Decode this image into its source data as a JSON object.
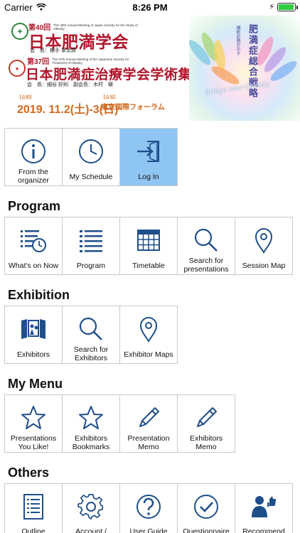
{
  "status_bar": {
    "carrier": "Carrier",
    "time": "8:26 PM",
    "battery_level": 0.95
  },
  "banner": {
    "conf1_ordinal": "第40回",
    "conf1_english": "The 40th Annual Meeting of Japan Society for the Study of Obesity",
    "conf1_title": "日本肥満学会",
    "conf1_president": "会　長：横手 幸太郎",
    "conf2_ordinal": "第37回",
    "conf2_english": "The 37th Annual Meeting of the Japanese Society for Treatment of Obesity",
    "conf2_title": "日本肥満症治療学会学術集会",
    "conf2_president": "会　長：細谷 好則　副会長：木村　穣",
    "period_label": "【会期】",
    "dates": "2019. 11.2(土)-3(日)",
    "venue_label": "【会場】",
    "venue": "東京国際フォーラム",
    "art_vertical_small": "横断診療が示す",
    "art_vertical": "肥満症総合戦略",
    "art_caption": "Bridge over Obesity"
  },
  "top_tiles": [
    {
      "name": "from-the-organizer",
      "icon": "info-icon",
      "label": "From the organizer",
      "active": false
    },
    {
      "name": "my-schedule",
      "icon": "clock-icon",
      "label": "My Schedule",
      "active": false
    },
    {
      "name": "log-in",
      "icon": "login-icon",
      "label": "Log In",
      "active": true
    }
  ],
  "sections": {
    "program": {
      "title": "Program",
      "tiles": [
        {
          "name": "whats-on-now",
          "icon": "list-clock-icon",
          "label": "What's on Now"
        },
        {
          "name": "program",
          "icon": "list-icon",
          "label": "Program"
        },
        {
          "name": "timetable",
          "icon": "calendar-grid-icon",
          "label": "Timetable"
        },
        {
          "name": "search-presentations",
          "icon": "search-icon",
          "label": "Search for presentations"
        },
        {
          "name": "session-map",
          "icon": "map-pin-icon",
          "label": "Session Map"
        }
      ]
    },
    "exhibition": {
      "title": "Exhibition",
      "tiles": [
        {
          "name": "exhibitors",
          "icon": "exhibitor-booth-icon",
          "label": "Exhibitors"
        },
        {
          "name": "search-exhibitors",
          "icon": "search-icon",
          "label": "Search for Exhibitors"
        },
        {
          "name": "exhibitor-maps",
          "icon": "map-pin-icon",
          "label": "Exhibitor Maps"
        }
      ]
    },
    "my_menu": {
      "title": "My Menu",
      "tiles": [
        {
          "name": "presentations-you-like",
          "icon": "star-icon",
          "label": "Presentations You Like!"
        },
        {
          "name": "exhibitors-bookmarks",
          "icon": "star-icon",
          "label": "Exhibitors Bookmarks"
        },
        {
          "name": "presentation-memo",
          "icon": "pencil-icon",
          "label": "Presentation Memo"
        },
        {
          "name": "exhibitors-memo",
          "icon": "pencil-icon",
          "label": "Exhibitors Memo"
        }
      ]
    },
    "others": {
      "title": "Others",
      "tiles": [
        {
          "name": "outline",
          "icon": "document-icon",
          "label": "Outline"
        },
        {
          "name": "account",
          "icon": "gear-icon",
          "label": "Account /"
        },
        {
          "name": "user-guide",
          "icon": "help-icon",
          "label": "User Guide"
        },
        {
          "name": "questionnaire",
          "icon": "checkmark-icon",
          "label": "Questionnaire"
        },
        {
          "name": "recommend",
          "icon": "recommend-person-icon",
          "label": "Recommend"
        }
      ]
    }
  },
  "colors": {
    "icon": "#1f4f8a",
    "active_tile": "#8fc5f2",
    "tile_border": "#c9c9c9",
    "banner_red": "#b0162b",
    "banner_orange": "#d2691e"
  }
}
